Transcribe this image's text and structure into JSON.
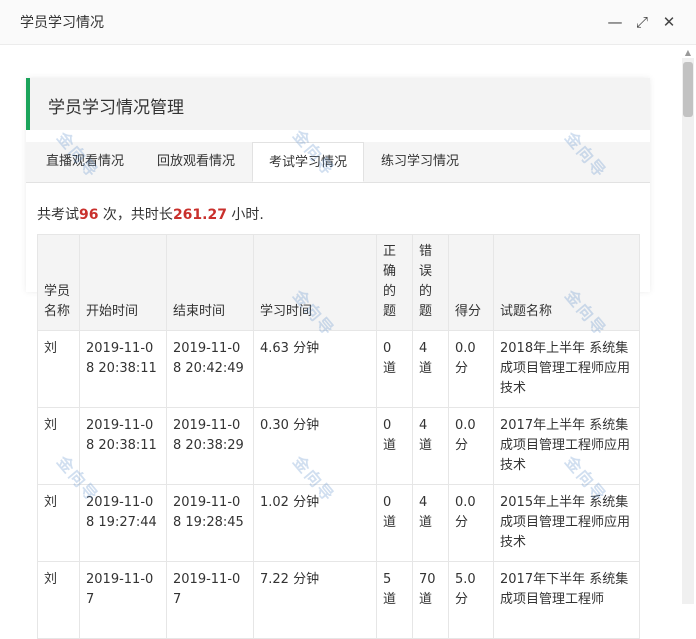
{
  "window": {
    "title": "学员学习情况",
    "minimize_glyph": "—",
    "maximize_glyph": "⤢",
    "close_glyph": "✕"
  },
  "section": {
    "title": "学员学习情况管理"
  },
  "tabs": [
    {
      "label": "直播观看情况",
      "active": false
    },
    {
      "label": "回放观看情况",
      "active": false
    },
    {
      "label": "考试学习情况",
      "active": true
    },
    {
      "label": "练习学习情况",
      "active": false
    }
  ],
  "summary": {
    "prefix": "共考试",
    "exam_count": "96",
    "middle": " 次，共时长",
    "total_hours": "261.27",
    "suffix": " 小时."
  },
  "table": {
    "headers": [
      "学员名称",
      "开始时间",
      "结束时间",
      "学习时间",
      "正确的题",
      "错误的题",
      "得分",
      "试题名称"
    ],
    "rows": [
      [
        "刘",
        "2019-11-08 20:38:11",
        "2019-11-08 20:42:49",
        "4.63  分钟",
        "0 道",
        "4 道",
        "0.0 分",
        "2018年上半年 系统集成项目管理工程师应用技术"
      ],
      [
        "刘",
        "2019-11-08 20:38:11",
        "2019-11-08 20:38:29",
        "0.30  分钟",
        "0 道",
        "4 道",
        "0.0 分",
        "2017年上半年 系统集成项目管理工程师应用技术"
      ],
      [
        "刘",
        "2019-11-08 19:27:44",
        "2019-11-08 19:28:45",
        "1.02  分钟",
        "0 道",
        "4 道",
        "0.0 分",
        "2015年上半年 系统集成项目管理工程师应用技术"
      ],
      [
        "刘",
        "2019-11-07",
        "2019-11-07",
        "7.22  分钟",
        "5 道",
        "70 道",
        "5.0 分",
        "2017年下半年 系统集成项目管理工程师"
      ]
    ]
  },
  "watermark": "金向导",
  "colors": {
    "accent_green": "#1aa35a",
    "highlight_red": "#c9302c"
  }
}
